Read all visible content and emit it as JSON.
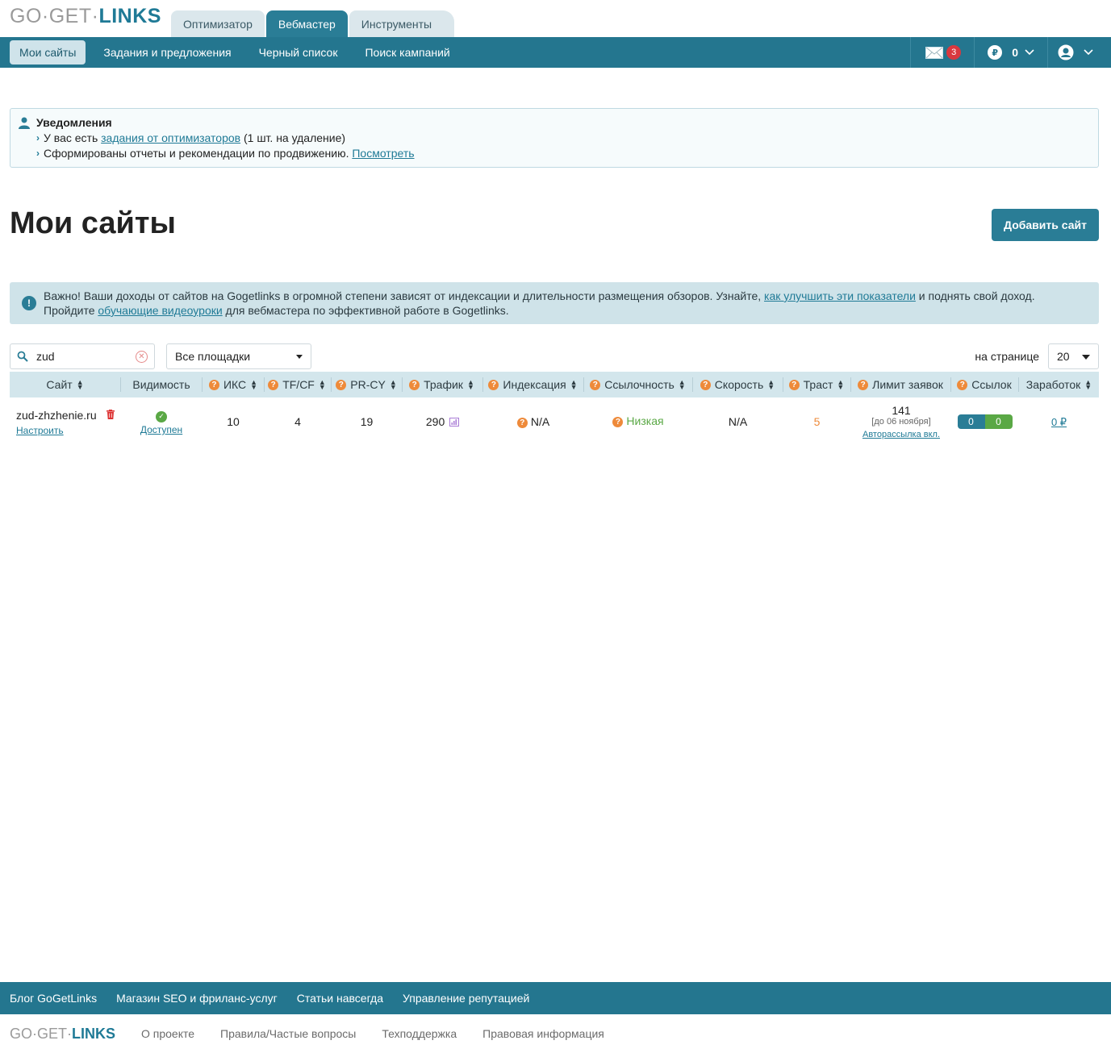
{
  "logo": {
    "part1": "GO·GET·",
    "part2": "LINKS"
  },
  "tabs": [
    "Оптимизатор",
    "Вебмастер",
    "Инструменты"
  ],
  "nav": {
    "items": [
      "Мои сайты",
      "Задания и предложения",
      "Черный список",
      "Поиск кампаний"
    ],
    "messages_count": "3",
    "balance": "0",
    "currency_symbol": "₽"
  },
  "notifications": {
    "title": "Уведомления",
    "line1_pre": "У вас есть ",
    "line1_link": "задания от оптимизаторов",
    "line1_post": " (1 шт. на удаление)",
    "line2_pre": "Сформированы отчеты и рекомендации по продвижению. ",
    "line2_link": "Посмотреть"
  },
  "page": {
    "title": "Мои сайты",
    "add_button": "Добавить сайт"
  },
  "info": {
    "icon": "!",
    "part1": "Важно! Ваши доходы от сайтов на Gogetlinks в огромной степени зависят от индексации и длительности размещения обзоров. Узнайте, ",
    "link1": "как улучшить эти показатели",
    "part2": " и поднять свой доход. Пройдите ",
    "link2": "обучающие видеоуроки",
    "part3": " для вебмастера по эффективной работе в Gogetlinks."
  },
  "filters": {
    "search_value": "zud",
    "platforms_select": "Все площадки",
    "per_page_label": "на странице",
    "per_page_value": "20"
  },
  "table": {
    "headers": [
      "Сайт",
      "Видимость",
      "ИКС",
      "TF/CF",
      "PR-CY",
      "Трафик",
      "Индексация",
      "Ссылочность",
      "Скорость",
      "Траст",
      "Лимит заявок",
      "Ссылок",
      "Заработок"
    ],
    "row": {
      "site": "zud-zhzhenie.ru",
      "configure": "Настроить",
      "visibility": "Доступен",
      "iks": "10",
      "tfcf": "4",
      "prcy": "19",
      "traffic": "290",
      "indexation": "N/A",
      "linkage": "Низкая",
      "speed": "N/A",
      "trust": "5",
      "limit": "141",
      "limit_until": "[до 06 ноября]",
      "autosend": "Авторассылка вкл.",
      "links_blue": "0",
      "links_green": "0",
      "earnings": "0 ₽"
    }
  },
  "footer": {
    "links": [
      "Блог GoGetLinks",
      "Магазин SEO и фриланс-услуг",
      "Статьи навсегда",
      "Управление репутацией"
    ],
    "bottom_links": [
      "О проекте",
      "Правила/Частые вопросы",
      "Техподдержка",
      "Правовая информация"
    ]
  },
  "colors": {
    "brand": "#24768f",
    "accent_orange": "#ee8a3a",
    "green": "#5aa845",
    "danger": "#d9383f"
  }
}
